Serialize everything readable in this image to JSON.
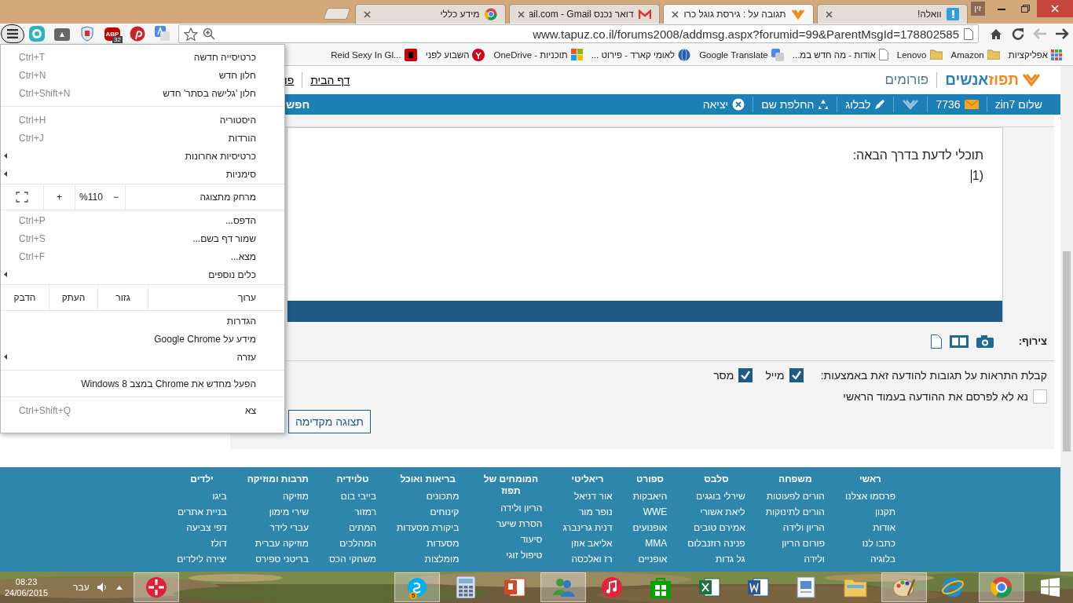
{
  "browser": {
    "tabs": [
      {
        "title": "וואלה!",
        "kind": "walla",
        "selected": false
      },
      {
        "title": "תגובה על : גירסת גוגל כרו",
        "kind": "tapuz",
        "selected": true
      },
      {
        "title": "דואר נכנס ail.com - Gmail",
        "kind": "mail",
        "selected": false
      },
      {
        "title": "מידע כללי",
        "kind": "globe",
        "selected": false
      }
    ],
    "profile": "זין",
    "nav": [
      {
        "kind": "home",
        "disabled": false
      },
      {
        "kind": "reload",
        "disabled": false
      },
      {
        "kind": "back",
        "disabled": true
      },
      {
        "kind": "forward",
        "disabled": false
      }
    ],
    "url": "www.tapuz.co.il/forums2008/addmsg.aspx?forumid=99&ParentMsgId=178802585",
    "extensions": [
      {
        "kind": "r-app"
      },
      {
        "kind": "drive"
      },
      {
        "kind": "shield"
      },
      {
        "kind": "abp",
        "label": "ABP",
        "badge": "32"
      },
      {
        "kind": "pin"
      },
      {
        "kind": "translate"
      }
    ],
    "bookmarks": [
      {
        "label": "אפליקציות",
        "kind": "apps"
      },
      {
        "label": "Amazon",
        "kind": "folder"
      },
      {
        "label": "Lenovo",
        "kind": "folder"
      },
      {
        "label": "אודות - מה חדש במ...",
        "kind": "page"
      },
      {
        "label": "Google Translate",
        "kind": "translate"
      },
      {
        "label": "לאומי קארד - פירוט ...",
        "kind": "globe"
      },
      {
        "label": "תוכניות - OneDrive",
        "kind": "flag"
      },
      {
        "label": "השבוע לפני",
        "kind": "y-logo"
      },
      {
        "label": "Reid Sexy In Gl...",
        "kind": "r-logo"
      }
    ]
  },
  "menu": {
    "groups": [
      [
        {
          "kind": "item",
          "label": "כרטיסייה חדשה",
          "shortcut": "Ctrl+T",
          "submenu": false
        },
        {
          "kind": "item",
          "label": "חלון חדש",
          "shortcut": "Ctrl+N",
          "submenu": false
        },
        {
          "kind": "item",
          "label": "חלון 'גלישה בסתר' חדש",
          "shortcut": "Ctrl+Shift+N",
          "submenu": false
        }
      ],
      [
        {
          "kind": "item",
          "label": "היסטוריה",
          "shortcut": "Ctrl+H",
          "submenu": false
        },
        {
          "kind": "item",
          "label": "הורדות",
          "shortcut": "Ctrl+J",
          "submenu": false
        },
        {
          "kind": "item",
          "label": "כרטיסיות אחרונות",
          "submenu": true
        },
        {
          "kind": "item",
          "label": "סימניות",
          "submenu": true
        }
      ],
      [
        {
          "kind": "zoom",
          "label": "מרחק מתצוגה",
          "minus": "−",
          "value": "%110",
          "plus": "+"
        }
      ],
      [
        {
          "kind": "item",
          "label": "הדפס...",
          "shortcut": "Ctrl+P",
          "submenu": false
        },
        {
          "kind": "item",
          "label": "שמור דף בשם...",
          "shortcut": "Ctrl+S",
          "submenu": false
        },
        {
          "kind": "item",
          "label": "מצא...",
          "shortcut": "Ctrl+F",
          "submenu": false
        },
        {
          "kind": "item",
          "label": "כלים נוספים",
          "submenu": true
        }
      ],
      [
        {
          "kind": "edit",
          "label": "ערוך",
          "actions": [
            "גזור",
            "העתק",
            "הדבק"
          ]
        }
      ],
      [
        {
          "kind": "item",
          "label": "הגדרות",
          "submenu": false
        },
        {
          "kind": "item",
          "label": "מידע על Google Chrome",
          "submenu": false
        },
        {
          "kind": "item",
          "label": "עזרה",
          "submenu": true
        }
      ],
      [
        {
          "kind": "item",
          "label": "הפעל מחדש את Chrome במצב Windows 8",
          "submenu": false
        }
      ],
      [
        {
          "kind": "item",
          "label": "צא",
          "shortcut": "Ctrl+Shift+Q",
          "submenu": false
        }
      ]
    ]
  },
  "site": {
    "logo": {
      "first": "תפוז",
      "second": "אנשים"
    },
    "section": "פורומים",
    "links": [
      "דף הבית",
      "פו"
    ],
    "greeting": "שלום zin7",
    "nav": [
      {
        "kind": "mail",
        "label": "7736"
      },
      {
        "kind": "logo"
      },
      {
        "kind": "pencil",
        "label": "לבלוג"
      },
      {
        "kind": "recycle",
        "label": "החלפת שם"
      },
      {
        "kind": "exit",
        "label": "יציאה"
      }
    ],
    "search": "חפש",
    "editor_lines": [
      "תוכלי לדעת בדרך הבאה:",
      "1)"
    ],
    "attach": {
      "label": "צירוף:",
      "icons": [
        {
          "kind": "camera"
        },
        {
          "kind": "film"
        },
        {
          "kind": "document"
        }
      ]
    },
    "notify": {
      "label": "קבלת התראות על תגובות להודעה זאת באמצעות:",
      "options": [
        {
          "label": "מייל",
          "checked": true
        },
        {
          "label": "מסר",
          "checked": true
        }
      ]
    },
    "no_publish": {
      "label": "נא לא לפרסם את ההודעה בעמוד הראשי",
      "checked": false
    },
    "preview_button": "תצוגה מקדימה",
    "footer": [
      {
        "title": "ראשי",
        "links": [
          "פרסמו אצלנו",
          "תקנון",
          "אודות",
          "כתבו לנו",
          "בלוגיה"
        ]
      },
      {
        "title": "משפחה",
        "links": [
          "הורים לפעוטות",
          "הורים לתינוקות",
          "הריון ולידה",
          "פורום הריון",
          "ולידה"
        ]
      },
      {
        "title": "סלבס",
        "links": [
          "שירלי בוגגים",
          "ליאת אשורי",
          "אמירם טובים",
          "פנינה רוזנבלום",
          "גל גדות"
        ]
      },
      {
        "title": "ספורט",
        "links": [
          "היאבקות",
          "WWE",
          "אופנועים",
          "MMA",
          "אופניים"
        ]
      },
      {
        "title": "ריאליטי",
        "links": [
          "אור דניאל",
          "נופר מור",
          "דנית גרינברג",
          "אליאב אוזן",
          "רז ואלכסה"
        ]
      },
      {
        "title": "המומחים של תפוז",
        "links": [
          "הריון ולידה",
          "הסרת שיער",
          "סיעוד",
          "טיפול זוגי"
        ]
      },
      {
        "title": "בריאות ואוכל",
        "links": [
          "מתכונים",
          "קינוחים",
          "ביקורת מסעדות",
          "מסעדות",
          "מומלצות"
        ]
      },
      {
        "title": "טלוידיה",
        "links": [
          "בייבי בום",
          "רמזור",
          "המתים",
          "המהלכים",
          "משחקי הכס"
        ]
      },
      {
        "title": "תרבות ומוזיקה",
        "links": [
          "מוזיקה",
          "שירי מימון",
          "עברי לידר",
          "מוזיקה עברית",
          "בריטני ספירס"
        ]
      },
      {
        "title": "ילדים",
        "links": [
          "ביגו",
          "בניית אתרים",
          "דפי צביעה",
          "דולז",
          "יצירה לילדים"
        ]
      }
    ]
  },
  "taskbar": {
    "tray": {
      "app_selected": true,
      "language": "עבר",
      "time": "08:23",
      "date": "24/06/2015"
    },
    "apps": [
      {
        "kind": "chat",
        "badge": "5",
        "selected": true
      },
      {
        "kind": "calculator",
        "selected": false
      },
      {
        "kind": "slides",
        "selected": false
      },
      {
        "kind": "messenger",
        "selected": true
      },
      {
        "kind": "music",
        "selected": false
      },
      {
        "kind": "store",
        "selected": false
      },
      {
        "kind": "sheet",
        "selected": false
      },
      {
        "kind": "word",
        "selected": false
      },
      {
        "kind": "reader",
        "selected": false
      },
      {
        "kind": "folder",
        "selected": false
      },
      {
        "kind": "paint",
        "selected": true
      },
      {
        "kind": "ie",
        "selected": false
      },
      {
        "kind": "globe",
        "selected": true
      },
      {
        "kind": "start",
        "selected": false
      }
    ]
  }
}
